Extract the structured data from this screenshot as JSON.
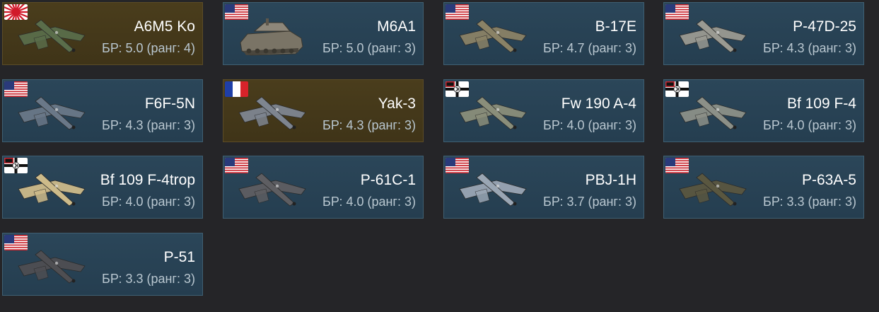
{
  "vehicles": [
    {
      "name": "A6M5 Ko",
      "br": "БР: 5.0 (ранг: 4)",
      "flag": "japan-flag-icon",
      "kind": "plane",
      "premium": true,
      "color": "#5a6d4a"
    },
    {
      "name": "M6A1",
      "br": "БР: 5.0 (ранг: 3)",
      "flag": "usa-flag-icon",
      "kind": "tank",
      "premium": false,
      "color": "#7a7466"
    },
    {
      "name": "B-17E",
      "br": "БР: 4.7 (ранг: 3)",
      "flag": "usa-flag-icon",
      "kind": "plane",
      "premium": false,
      "color": "#8a8266"
    },
    {
      "name": "P-47D-25",
      "br": "БР: 4.3 (ранг: 3)",
      "flag": "usa-flag-icon",
      "kind": "plane",
      "premium": false,
      "color": "#9a9a92"
    },
    {
      "name": "F6F-5N",
      "br": "БР: 4.3 (ранг: 3)",
      "flag": "usa-flag-icon",
      "kind": "plane",
      "premium": false,
      "color": "#6a7888"
    },
    {
      "name": "Yak-3",
      "br": "БР: 4.3 (ранг: 3)",
      "flag": "france-flag-icon",
      "kind": "plane",
      "premium": true,
      "color": "#7e8590"
    },
    {
      "name": "Fw 190 A-4",
      "br": "БР: 4.0 (ранг: 3)",
      "flag": "germany-flag-icon",
      "kind": "plane",
      "premium": false,
      "color": "#8a8e7a"
    },
    {
      "name": "Bf 109 F-4",
      "br": "БР: 4.0 (ранг: 3)",
      "flag": "germany-flag-icon",
      "kind": "plane",
      "premium": false,
      "color": "#8c9088"
    },
    {
      "name": "Bf 109 F-4trop",
      "br": "БР: 4.0 (ранг: 3)",
      "flag": "germany-flag-icon",
      "kind": "plane",
      "premium": false,
      "color": "#cdbb8a"
    },
    {
      "name": "P-61C-1",
      "br": "БР: 4.0 (ранг: 3)",
      "flag": "usa-flag-icon",
      "kind": "plane",
      "premium": false,
      "color": "#5e5e62"
    },
    {
      "name": "PBJ-1H",
      "br": "БР: 3.7 (ранг: 3)",
      "flag": "usa-flag-icon",
      "kind": "plane",
      "premium": false,
      "color": "#9aa6b4"
    },
    {
      "name": "P-63A-5",
      "br": "БР: 3.3 (ранг: 3)",
      "flag": "usa-flag-icon",
      "kind": "plane",
      "premium": false,
      "color": "#5a5740"
    },
    {
      "name": "P-51",
      "br": "БР: 3.3 (ранг: 3)",
      "flag": "usa-flag-icon",
      "kind": "plane",
      "premium": false,
      "color": "#4e4e52"
    }
  ]
}
